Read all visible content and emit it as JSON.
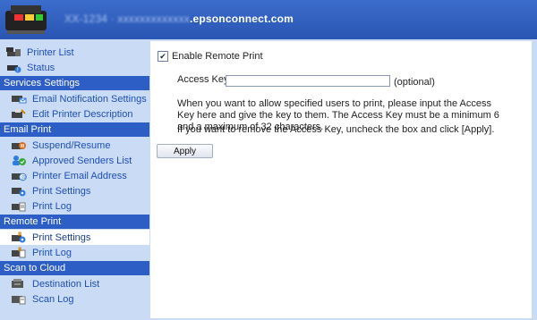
{
  "header": {
    "title_blurred": "XX-1234 · xxxxxxxxxxxxx",
    "title_domain": ".epsonconnect.com"
  },
  "sidebar": {
    "top_items": [
      {
        "label": "Printer List",
        "icon": "printer-list-icon"
      },
      {
        "label": "Status",
        "icon": "status-icon"
      }
    ],
    "sections": [
      {
        "title": "Services Settings",
        "items": [
          {
            "label": "Email Notification Settings",
            "icon": "email-notification-icon"
          },
          {
            "label": "Edit Printer Description",
            "icon": "printer-description-icon"
          }
        ]
      },
      {
        "title": "Email Print",
        "items": [
          {
            "label": "Suspend/Resume",
            "icon": "suspend-resume-icon"
          },
          {
            "label": "Approved Senders List",
            "icon": "approved-senders-icon"
          },
          {
            "label": "Printer Email Address",
            "icon": "printer-email-icon"
          },
          {
            "label": "Print Settings",
            "icon": "print-settings-icon"
          },
          {
            "label": "Print Log",
            "icon": "print-log-icon"
          }
        ]
      },
      {
        "title": "Remote Print",
        "items": [
          {
            "label": "Print Settings",
            "icon": "remote-print-settings-icon",
            "active": true
          },
          {
            "label": "Print Log",
            "icon": "remote-print-log-icon"
          }
        ]
      },
      {
        "title": "Scan to Cloud",
        "items": [
          {
            "label": "Destination List",
            "icon": "destination-list-icon"
          },
          {
            "label": "Scan Log",
            "icon": "scan-log-icon"
          }
        ]
      }
    ]
  },
  "main": {
    "enable_label": "Enable Remote Print",
    "enable_checked": true,
    "access_key_label": "Access Key:",
    "access_key_value": "",
    "optional_label": "(optional)",
    "description": "When you want to allow specified users to print, please input the Access Key here and give the key to them. The Access Key must be a minimum 6 and a maximum of 32 characters.",
    "remove_note": "If you want to remove the Access Key, uncheck the box and click [Apply].",
    "apply_label": "Apply"
  },
  "colors": {
    "header": "#2d5ec6",
    "section": "#2d5ec6",
    "sidebar_bg": "#c9dbf5",
    "link": "#1f4fb5"
  }
}
